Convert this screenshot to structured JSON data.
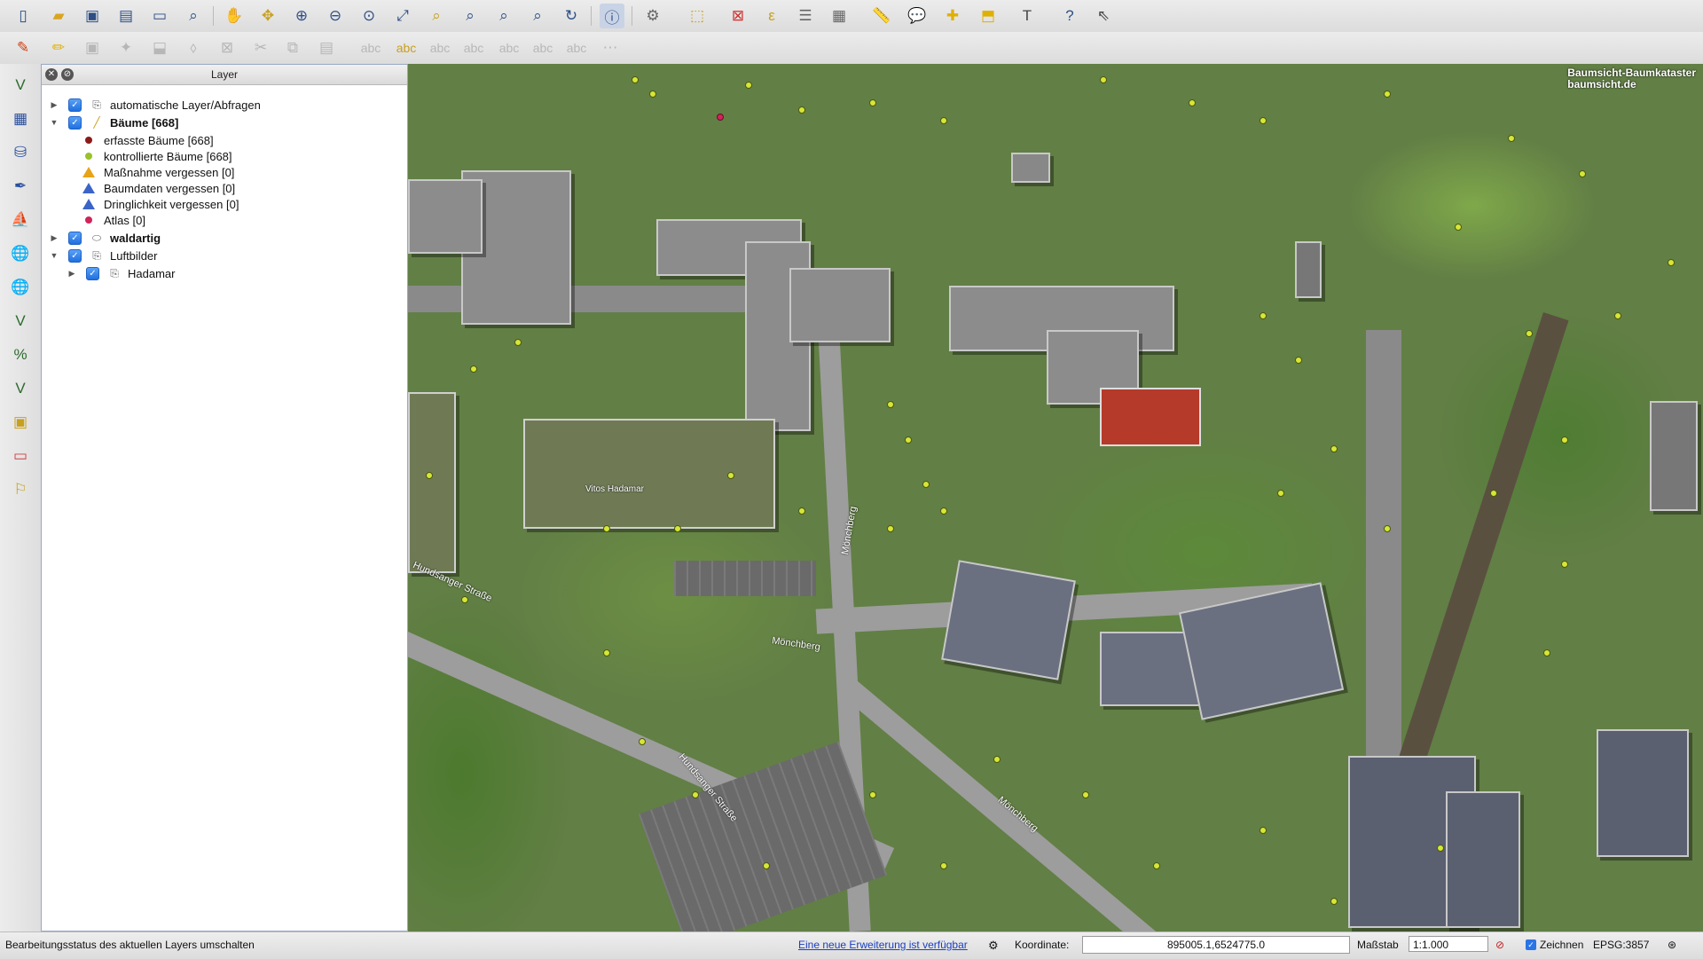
{
  "toolbar_main": [
    "new-project",
    "open-project",
    "save-project",
    "save-as",
    "new-print-composer",
    "composer-manager",
    "pan",
    "pan-to-selection",
    "zoom-in",
    "zoom-out",
    "zoom-actual",
    "zoom-full",
    "zoom-to-selection",
    "zoom-to-layer",
    "zoom-last",
    "zoom-next",
    "refresh",
    "identify",
    "select",
    "deselect",
    "measure",
    "attribute-table",
    "field-calculator",
    "statistics",
    "annotation",
    "map-tips",
    "new-bookmark",
    "text-annotation",
    "help",
    "whats-this"
  ],
  "toolbar_edit": [
    "toggle-editing",
    "current-edits",
    "save-edits",
    "add-feature",
    "move-feature",
    "node-tool",
    "delete-selected",
    "cut-features",
    "copy-features",
    "paste-features",
    "label-tool",
    "pin-labels",
    "show-hide-labels",
    "move-label",
    "rotate-label",
    "change-label",
    "label-properties"
  ],
  "layer_panel": {
    "title": "Layer",
    "layers": [
      {
        "label": "automatische Layer/Abfragen",
        "type": "group",
        "expanded": false,
        "checked": true
      },
      {
        "label": "Bäume [668]",
        "type": "layer",
        "expanded": true,
        "checked": true,
        "bold": true
      },
      {
        "label": "erfasste Bäume [668]",
        "type": "symbol",
        "color": "#8b1a1a"
      },
      {
        "label": "kontrollierte Bäume [668]",
        "type": "symbol",
        "color": "#9ac22b"
      },
      {
        "label": "Maßnahme vergessen [0]",
        "type": "symbol-triangle",
        "color": "#e8a317"
      },
      {
        "label": "Baumdaten vergessen [0]",
        "type": "symbol-triangle",
        "color": "#3a64c8"
      },
      {
        "label": "Dringlichkeit vergessen [0]",
        "type": "symbol-triangle",
        "color": "#3a64c8"
      },
      {
        "label": "Atlas [0]",
        "type": "symbol",
        "color": "#d0245a"
      },
      {
        "label": "waldartig",
        "type": "layer",
        "expanded": false,
        "checked": true,
        "bold": true
      },
      {
        "label": "Luftbilder",
        "type": "group",
        "expanded": true,
        "checked": true
      },
      {
        "label": "Hadamar",
        "type": "group",
        "expanded": false,
        "checked": true
      }
    ]
  },
  "map": {
    "watermark_line1": "Baumsicht-Baumkataster",
    "watermark_line2": "baumsicht.de",
    "street_labels": [
      "Hundsanger Straße",
      "Mönchberg",
      "Hundsanger Straße",
      "Mönchberg",
      "Mönchberg"
    ],
    "building_label": "Vitos Hadamar"
  },
  "statusbar": {
    "message": "Bearbeitungsstatus des aktuellen Layers umschalten",
    "extension_link": "Eine neue Erweiterung ist verfügbar",
    "coord_label": "Koordinate:",
    "coord_value": "895005.1,6524775.0",
    "scale_label": "Maßstab",
    "scale_value": "1:1.000",
    "render_label": "Zeichnen",
    "crs": "EPSG:3857"
  }
}
